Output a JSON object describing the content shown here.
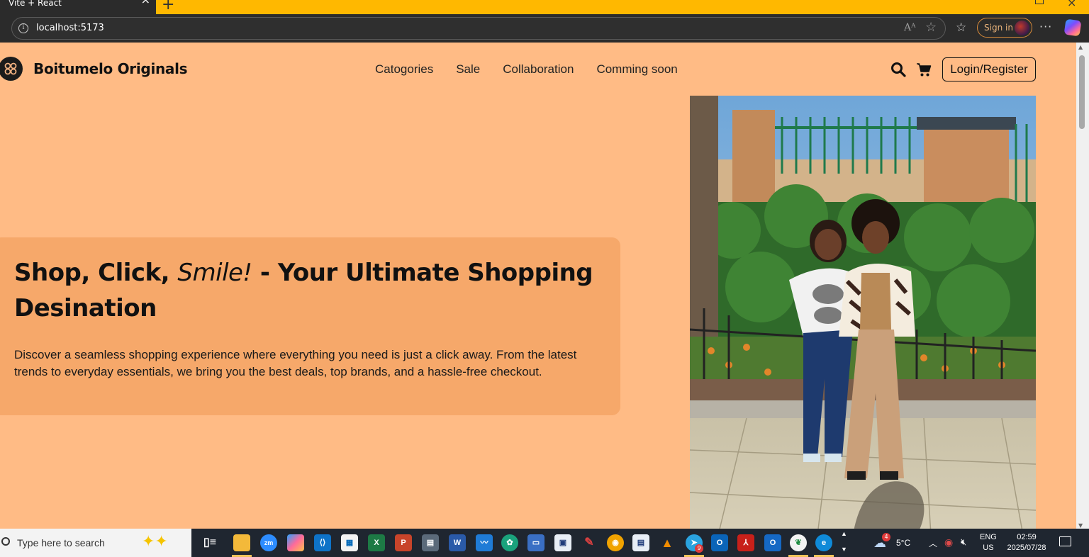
{
  "browser": {
    "tab_title": "Vite + React",
    "url": "localhost:5173",
    "signin_label": "Sign in"
  },
  "site": {
    "brand_name": "Boitumelo Originals",
    "nav": [
      "Catogories",
      "Sale",
      "Collaboration",
      "Comming soon"
    ],
    "login_label": "Login/Register"
  },
  "hero": {
    "title_part1": "Shop, Click, ",
    "title_italic": "Smile!",
    "title_part2": " - Your Ultimate Shopping Desination",
    "description": "Discover a seamless shopping experience where everything you need is just a click away. From the latest trends to everyday essentials, we bring you the best deals, top brands, and a hassle-free checkout.",
    "image_alt": "Two women posing in front of a green fence and hedge"
  },
  "taskbar": {
    "search_placeholder": "Type here to search",
    "weather": "5°C",
    "weather_badge": "4",
    "lang_line1": "ENG",
    "lang_line2": "US",
    "time": "02:59",
    "date": "2025/07/28",
    "telegram_badge": "9"
  },
  "colors": {
    "page_bg": "#ffbb85",
    "hero_card_bg": "#f6a86a",
    "tabbar_bg": "#ffb800",
    "taskbar_bg": "#1f2630"
  },
  "icons": [
    "info-icon",
    "read-aloud-icon",
    "favorite-star-icon",
    "favorites-icon",
    "more-icon",
    "copilot-icon",
    "search-icon",
    "cart-icon",
    "logo-icon"
  ]
}
